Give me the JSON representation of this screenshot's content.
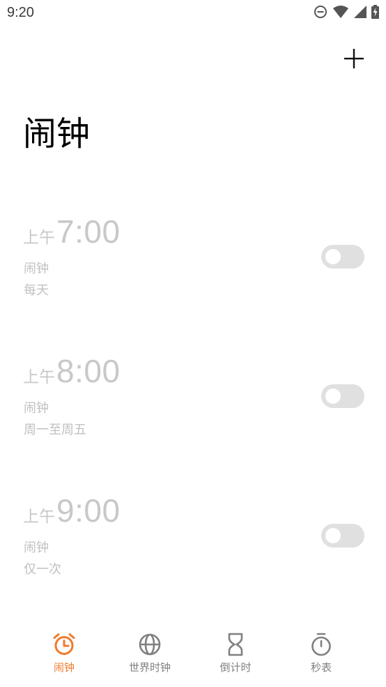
{
  "status_bar": {
    "time": "9:20",
    "icons": [
      "do-not-disturb-icon",
      "wifi-icon",
      "signal-icon",
      "battery-charging-icon"
    ]
  },
  "header": {
    "add_icon": "plus-icon",
    "title": "闹钟"
  },
  "alarms": [
    {
      "ampm": "上午",
      "time": "7:00",
      "label": "闹钟",
      "repeat": "每天",
      "enabled": false
    },
    {
      "ampm": "上午",
      "time": "8:00",
      "label": "闹钟",
      "repeat": "周一至周五",
      "enabled": false
    },
    {
      "ampm": "上午",
      "time": "9:00",
      "label": "闹钟",
      "repeat": "仅一次",
      "enabled": false
    }
  ],
  "bottom_nav": {
    "items": [
      {
        "label": "闹钟",
        "icon": "alarm-clock-icon",
        "active": true
      },
      {
        "label": "世界时钟",
        "icon": "globe-icon",
        "active": false
      },
      {
        "label": "倒计时",
        "icon": "hourglass-icon",
        "active": false
      },
      {
        "label": "秒表",
        "icon": "stopwatch-icon",
        "active": false
      }
    ]
  },
  "colors": {
    "accent": "#f07a2b",
    "inactive_text": "#c8c8c8",
    "nav_inactive": "#808080",
    "toggle_off": "#e0e0e0"
  }
}
